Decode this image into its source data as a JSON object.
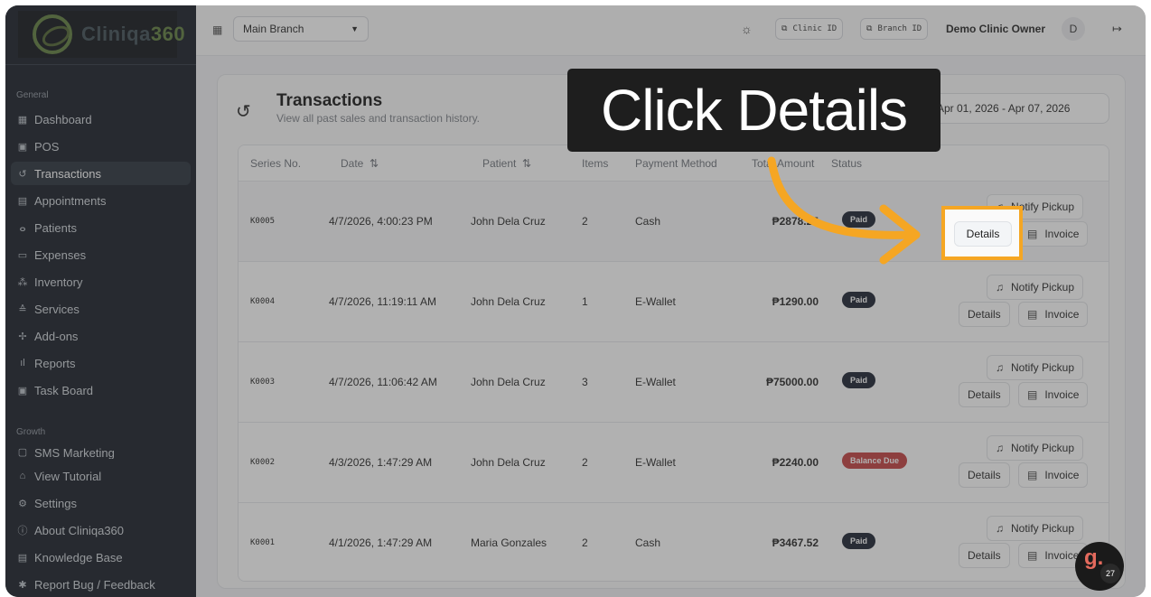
{
  "brand": {
    "name_part1": "Cliniqa",
    "name_part2": "360"
  },
  "sidebar": {
    "section_general": "General",
    "section_growth": "Growth",
    "items": [
      {
        "label": "Dashboard",
        "icon": "dashboard-icon"
      },
      {
        "label": "POS",
        "icon": "pos-icon"
      },
      {
        "label": "Transactions",
        "icon": "history-icon",
        "active": true
      },
      {
        "label": "Appointments",
        "icon": "calendar-icon"
      },
      {
        "label": "Patients",
        "icon": "users-icon"
      },
      {
        "label": "Expenses",
        "icon": "wallet-icon"
      },
      {
        "label": "Inventory",
        "icon": "boxes-icon"
      },
      {
        "label": "Services",
        "icon": "services-icon"
      },
      {
        "label": "Add-ons",
        "icon": "puzzle-icon"
      },
      {
        "label": "Reports",
        "icon": "chart-icon"
      },
      {
        "label": "Task Board",
        "icon": "board-icon"
      }
    ],
    "growth_items": [
      {
        "label": "SMS Marketing",
        "icon": "sms-icon"
      }
    ],
    "bottom_items": [
      {
        "label": "View Tutorial",
        "icon": "graduation-icon"
      },
      {
        "label": "Settings",
        "icon": "gear-icon"
      },
      {
        "label": "About Cliniqa360",
        "icon": "info-icon"
      },
      {
        "label": "Knowledge Base",
        "icon": "book-icon"
      },
      {
        "label": "Report Bug / Feedback",
        "icon": "bug-icon"
      }
    ]
  },
  "topbar": {
    "branch": "Main Branch",
    "clinic_id": "Clinic ID",
    "branch_id": "Branch ID",
    "owner": "Demo Clinic Owner",
    "avatar": "D"
  },
  "page": {
    "title": "Transactions",
    "subtitle": "View all past sales and transaction history.",
    "date_range": "Apr 01, 2026 - Apr 07, 2026"
  },
  "table": {
    "headers": {
      "series": "Series No.",
      "date": "Date",
      "patient": "Patient",
      "items": "Items",
      "method": "Payment Method",
      "total": "Total Amount",
      "status": "Status"
    },
    "rows": [
      {
        "series": "K0005",
        "date": "4/7/2026, 4:00:23 PM",
        "patient": "John Dela Cruz",
        "items": "2",
        "method": "Cash",
        "total": "₱2878.25",
        "status": "Paid"
      },
      {
        "series": "K0004",
        "date": "4/7/2026, 11:19:11 AM",
        "patient": "John Dela Cruz",
        "items": "1",
        "method": "E-Wallet",
        "total": "₱1290.00",
        "status": "Paid"
      },
      {
        "series": "K0003",
        "date": "4/7/2026, 11:06:42 AM",
        "patient": "John Dela Cruz",
        "items": "3",
        "method": "E-Wallet",
        "total": "₱75000.00",
        "status": "Paid"
      },
      {
        "series": "K0002",
        "date": "4/3/2026, 1:47:29 AM",
        "patient": "John Dela Cruz",
        "items": "2",
        "method": "E-Wallet",
        "total": "₱2240.00",
        "status": "Balance Due"
      },
      {
        "series": "K0001",
        "date": "4/1/2026, 1:47:29 AM",
        "patient": "Maria Gonzales",
        "items": "2",
        "method": "Cash",
        "total": "₱3467.52",
        "status": "Paid"
      }
    ],
    "actions": {
      "notify": "Notify Pickup",
      "details": "Details",
      "invoice": "Invoice"
    }
  },
  "callout": {
    "text": "Click Details",
    "accent": "#f5a623"
  },
  "chat": {
    "glyph": "g.",
    "count": "27"
  }
}
